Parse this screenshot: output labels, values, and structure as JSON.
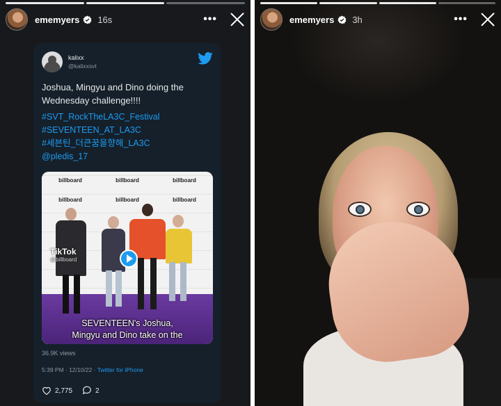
{
  "left_story": {
    "username": "ememyers",
    "time": "16s",
    "tweet": {
      "name": "kalixx",
      "handle": "@kalixxsvt",
      "text": "Joshua, Mingyu and Dino doing the Wednesday challenge!!!!",
      "tags": [
        "#SVT_RockTheLA3C_Festival",
        "#SEVENTEEN_AT_LA3C",
        "#세븐틴_더큰꿈을향해_LA3C",
        "@pledis_17"
      ],
      "media": {
        "tiktok_label": "TikTok",
        "tiktok_handle": "@billboard",
        "wall_logo": "billboard",
        "caption_line1": "SEVENTEEN's Joshua,",
        "caption_line2": "Mingyu and Dino take on the"
      },
      "views": "36.9K views",
      "date": "5:39 PM · 12/10/22 · ",
      "source": "Twitter for iPhone",
      "likes": "2,775",
      "comments": "2"
    }
  },
  "right_story": {
    "username": "ememyers",
    "time": "3h"
  },
  "icons": {
    "verified": "verified-badge-icon",
    "more": "more-options-icon",
    "close": "close-icon",
    "twitter": "twitter-bird-icon",
    "heart": "heart-icon",
    "comment": "comment-icon",
    "play": "play-icon"
  },
  "colors": {
    "twitter_blue": "#1d9bf0",
    "tweet_bg": "#15202b"
  }
}
